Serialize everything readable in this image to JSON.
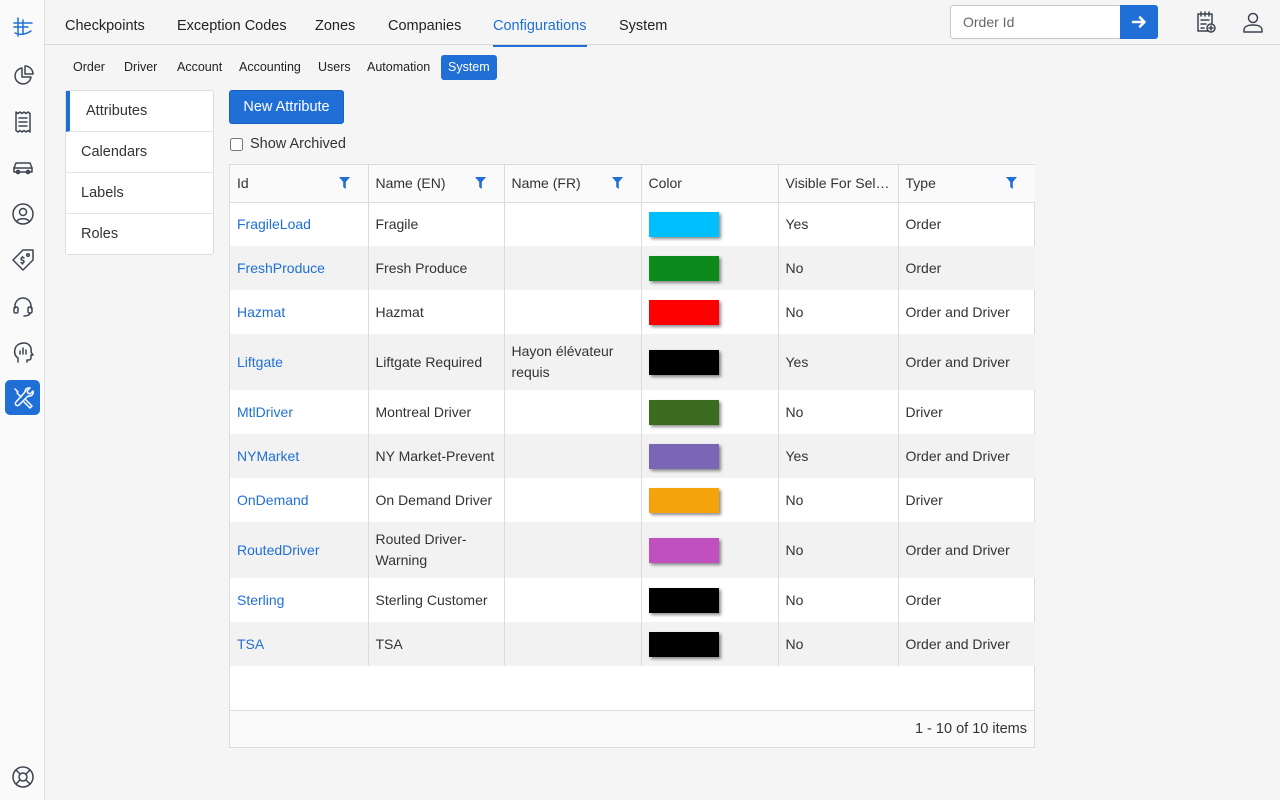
{
  "top_tabs": [
    {
      "label": "Checkpoints"
    },
    {
      "label": "Exception Codes"
    },
    {
      "label": "Zones"
    },
    {
      "label": "Companies"
    },
    {
      "label": "Configurations",
      "active": true
    },
    {
      "label": "System"
    }
  ],
  "search": {
    "placeholder": "Order Id"
  },
  "sub_tabs": [
    {
      "label": "Order"
    },
    {
      "label": "Driver"
    },
    {
      "label": "Account"
    },
    {
      "label": "Accounting"
    },
    {
      "label": "Users"
    },
    {
      "label": "Automation"
    },
    {
      "label": "System",
      "active": true
    }
  ],
  "side_menu": [
    {
      "label": "Attributes",
      "active": true
    },
    {
      "label": "Calendars"
    },
    {
      "label": "Labels"
    },
    {
      "label": "Roles"
    }
  ],
  "actions": {
    "new_label": "New Attribute",
    "archived_label": "Show Archived"
  },
  "grid": {
    "columns": [
      "Id",
      "Name (EN)",
      "Name (FR)",
      "Color",
      "Visible For Self…",
      "Type"
    ],
    "rows": [
      {
        "id": "FragileLoad",
        "name_en": "Fragile",
        "name_fr": "",
        "color": "#00bfff",
        "visible": "Yes",
        "type": "Order"
      },
      {
        "id": "FreshProduce",
        "name_en": "Fresh Produce",
        "name_fr": "",
        "color": "#0c8a1c",
        "visible": "No",
        "type": "Order"
      },
      {
        "id": "Hazmat",
        "name_en": "Hazmat",
        "name_fr": "",
        "color": "#ff0000",
        "visible": "No",
        "type": "Order and Driver"
      },
      {
        "id": "Liftgate",
        "name_en": "Liftgate Required",
        "name_fr": "Hayon élévateur requis",
        "color": "#000000",
        "visible": "Yes",
        "type": "Order and Driver"
      },
      {
        "id": "MtlDriver",
        "name_en": "Montreal Driver",
        "name_fr": "",
        "color": "#3b6b1e",
        "visible": "No",
        "type": "Driver"
      },
      {
        "id": "NYMarket",
        "name_en": "NY Market-Prevent",
        "name_fr": "",
        "color": "#7b65b5",
        "visible": "Yes",
        "type": "Order and Driver"
      },
      {
        "id": "OnDemand",
        "name_en": "On Demand Driver",
        "name_fr": "",
        "color": "#f4a30c",
        "visible": "No",
        "type": "Driver"
      },
      {
        "id": "RoutedDriver",
        "name_en": "Routed Driver-Warning",
        "name_fr": "",
        "color": "#c04fbf",
        "visible": "No",
        "type": "Order and Driver"
      },
      {
        "id": "Sterling",
        "name_en": "Sterling Customer",
        "name_fr": "",
        "color": "#000000",
        "visible": "No",
        "type": "Order"
      },
      {
        "id": "TSA",
        "name_en": "TSA",
        "name_fr": "",
        "color": "#000000",
        "visible": "No",
        "type": "Order and Driver"
      }
    ],
    "pager": "1 - 10 of 10 items"
  },
  "theme": {
    "accent": "#1f6fd6"
  }
}
